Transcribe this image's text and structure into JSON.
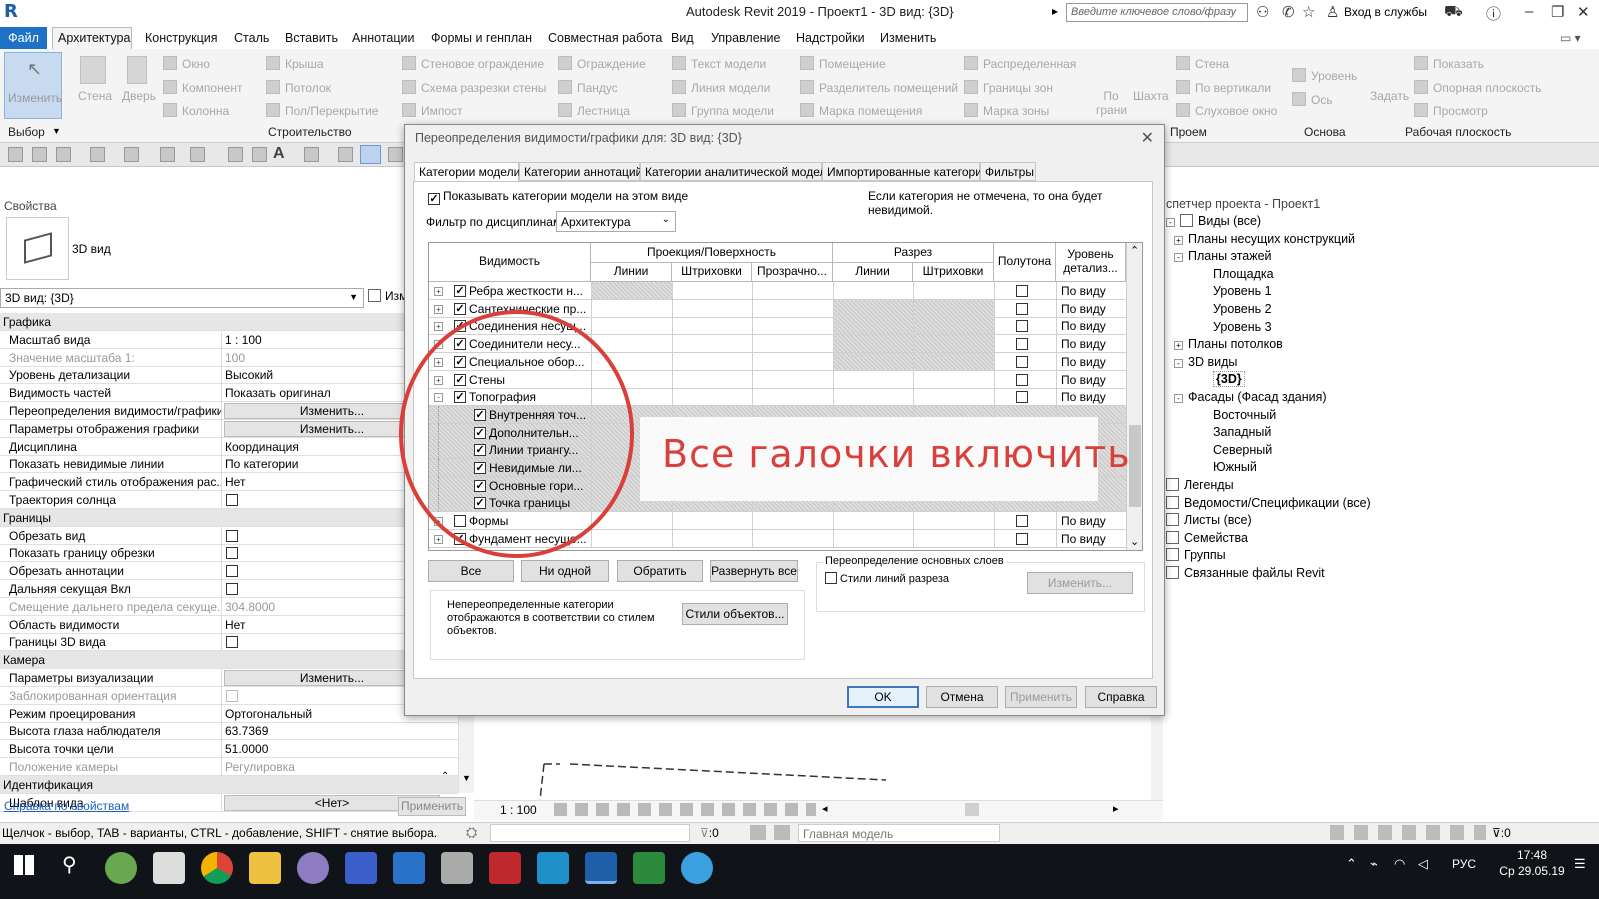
{
  "app": {
    "title": "Autodesk Revit 2019 - Проект1 - 3D вид: {3D}",
    "logo": "R",
    "search_placeholder": "Введите ключевое слово/фразу",
    "signin": "Вход в службы"
  },
  "menu": {
    "file": "Файл",
    "tabs": [
      "Архитектура",
      "Конструкция",
      "Сталь",
      "Вставить",
      "Аннотации",
      "Формы и генплан",
      "Совместная работа",
      "Вид",
      "Управление",
      "Надстройки",
      "Изменить"
    ]
  },
  "ribbon": {
    "select_label": "Изменить",
    "select_group": "Выбор",
    "wall": "Стена",
    "door": "Дверь",
    "window": "Окно",
    "component": "Компонент",
    "column": "Колонна",
    "roof": "Крыша",
    "ceiling": "Потолок",
    "floor": "Пол/Перекрытие",
    "curtain": "Стеновое ограждение",
    "curtain_grid": "Схема разрезки стены",
    "mullion": "Импост",
    "railing": "Ограждение",
    "ramp": "Пандус",
    "stair": "Лестница",
    "build_group": "Строительство",
    "model_text": "Текст модели",
    "model_line": "Линия модели",
    "model_group": "Группа модели",
    "room": "Помещение",
    "room_sep": "Разделитель помещений",
    "room_tag": "Марка помещения",
    "area": "Распределенная",
    "area_bound": "Границы зон",
    "area_tag": "Марка зоны",
    "by_face": "По грани",
    "shaft": "Шахта",
    "wall_open": "Стена",
    "vertical": "По вертикали",
    "dormer": "Слуховое окно",
    "opening_group": "Проем",
    "level": "Уровень",
    "grid": "Ось",
    "datum_group": "Основа",
    "set": "Задать",
    "show": "Показать",
    "ref_plane": "Опорная плоскость",
    "viewer": "Просмотр",
    "workplane_group": "Рабочая плоскость"
  },
  "properties": {
    "header": "Свойства",
    "type_name": "3D вид",
    "selector": "3D вид: {3D}",
    "edit_type": "Изм",
    "rows": [
      {
        "k": "Графика",
        "cat": true
      },
      {
        "k": "Масштаб вида",
        "v": "1 : 100"
      },
      {
        "k": "Значение масштаба    1:",
        "v": "100",
        "gray": true
      },
      {
        "k": "Уровень детализации",
        "v": "Высокий"
      },
      {
        "k": "Видимость частей",
        "v": "Показать оригинал"
      },
      {
        "k": "Переопределения видимости/графики",
        "btn": "Изменить..."
      },
      {
        "k": "Параметры отображения графики",
        "btn": "Изменить..."
      },
      {
        "k": "Дисциплина",
        "v": "Координация"
      },
      {
        "k": "Показать невидимые линии",
        "v": "По категории"
      },
      {
        "k": "Графический стиль отображения рас...",
        "v": "Нет"
      },
      {
        "k": "Траектория солнца",
        "chk": true
      },
      {
        "k": "Границы",
        "cat": true
      },
      {
        "k": "Обрезать вид",
        "chk": true
      },
      {
        "k": "Показать границу обрезки",
        "chk": true
      },
      {
        "k": "Обрезать аннотации",
        "chk": true
      },
      {
        "k": "Дальняя секущая Вкл",
        "chk": true
      },
      {
        "k": "Смещение дальнего предела секуще...",
        "v": "304.8000",
        "gray": true
      },
      {
        "k": "Область видимости",
        "v": "Нет"
      },
      {
        "k": "Границы 3D вида",
        "chk": true
      },
      {
        "k": "Камера",
        "cat": true
      },
      {
        "k": "Параметры визуализации",
        "btn": "Изменить..."
      },
      {
        "k": "Заблокированная ориентация",
        "chk": true,
        "gray": true
      },
      {
        "k": "Режим проецирования",
        "v": "Ортогональный"
      },
      {
        "k": "Высота глаза наблюдателя",
        "v": "63.7369"
      },
      {
        "k": "Высота точки цели",
        "v": "51.0000"
      },
      {
        "k": "Положение камеры",
        "v": "Регулировка",
        "gray": true
      },
      {
        "k": "Идентификация",
        "cat": true
      },
      {
        "k": "Шаблон вида",
        "btn": "<Нет>"
      }
    ],
    "help_link": "Справка по свойствам",
    "apply": "Применить"
  },
  "browser": {
    "header": "спетчер проекта - Проект1",
    "items": [
      {
        "t": "Виды (все)",
        "lvl": 0,
        "ico": true,
        "pm": "-"
      },
      {
        "t": "Планы несущих конструкций",
        "lvl": 1,
        "pm": "+"
      },
      {
        "t": "Планы этажей",
        "lvl": 1,
        "pm": "-"
      },
      {
        "t": "Площадка",
        "lvl": 2
      },
      {
        "t": "Уровень 1",
        "lvl": 2
      },
      {
        "t": "Уровень 2",
        "lvl": 2
      },
      {
        "t": "Уровень 3",
        "lvl": 2
      },
      {
        "t": "Планы потолков",
        "lvl": 1,
        "pm": "+"
      },
      {
        "t": "3D виды",
        "lvl": 1,
        "pm": "-"
      },
      {
        "t": "{3D}",
        "lvl": 2,
        "bold": true
      },
      {
        "t": "Фасады (Фасад здания)",
        "lvl": 1,
        "pm": "-"
      },
      {
        "t": "Восточный",
        "lvl": 2
      },
      {
        "t": "Западный",
        "lvl": 2
      },
      {
        "t": "Северный",
        "lvl": 2
      },
      {
        "t": "Южный",
        "lvl": 2
      },
      {
        "t": "Легенды",
        "lvl": 0,
        "ico": true
      },
      {
        "t": "Ведомости/Спецификации (все)",
        "lvl": 0,
        "ico": true
      },
      {
        "t": "Листы (все)",
        "lvl": 0,
        "ico": true
      },
      {
        "t": "Семейства",
        "lvl": 0,
        "ico": true
      },
      {
        "t": "Группы",
        "lvl": 0,
        "ico": true
      },
      {
        "t": "Связанные файлы Revit",
        "lvl": 0,
        "ico": true
      }
    ]
  },
  "dialog": {
    "title": "Переопределения видимости/графики для: 3D вид: {3D}",
    "tabs": [
      "Категории модели",
      "Категории аннотаций",
      "Категории аналитической модели",
      "Импортированные категории",
      "Фильтры"
    ],
    "show_categories": "Показывать категории модели на этом виде",
    "hint": "Если категория не отмечена, то она будет невидимой.",
    "filter_label": "Фильтр по дисциплинам:",
    "filter_value": "Архитектура",
    "headers": {
      "visibility": "Видимость",
      "projection": "Проекция/Поверхность",
      "cut": "Разрез",
      "lines": "Линии",
      "patterns": "Штриховки",
      "transparency": "Прозрачно...",
      "halftone": "Полутона",
      "detail": "Уровень детализ..."
    },
    "rows": [
      {
        "name": "Ребра жесткости н...",
        "exp": "+",
        "on": true,
        "half": true,
        "lv": "По виду",
        "h": [
          2
        ]
      },
      {
        "name": "Сантехнические пр...",
        "exp": "+",
        "on": true,
        "half": true,
        "lv": "По виду",
        "h": [
          5,
          6
        ]
      },
      {
        "name": "Соединения несущ...",
        "exp": "+",
        "on": true,
        "half": true,
        "lv": "По виду",
        "h": [
          5,
          6
        ]
      },
      {
        "name": "Соединители несу...",
        "exp": "+",
        "on": true,
        "half": true,
        "lv": "По виду",
        "h": [
          5,
          6
        ]
      },
      {
        "name": "Специальное обор...",
        "exp": "+",
        "on": true,
        "half": true,
        "lv": "По виду",
        "h": [
          5,
          6
        ]
      },
      {
        "name": "Стены",
        "exp": "+",
        "on": true,
        "half": true,
        "lv": "По виду",
        "h": []
      },
      {
        "name": "Топография",
        "exp": "-",
        "on": true,
        "half": true,
        "lv": "По виду",
        "h": []
      },
      {
        "name": "Внутренняя точ...",
        "child": true,
        "on": true,
        "h": [
          1,
          2,
          3,
          4,
          5,
          6,
          7,
          8
        ]
      },
      {
        "name": "Дополнительн...",
        "child": true,
        "on": true,
        "h": [
          1,
          2,
          3,
          4,
          5,
          6,
          7,
          8
        ]
      },
      {
        "name": "Линии триангу...",
        "child": true,
        "on": true,
        "h": [
          1,
          2,
          3,
          4,
          5,
          6,
          7,
          8
        ]
      },
      {
        "name": "Невидимые ли...",
        "child": true,
        "on": true,
        "h": [
          1,
          2,
          3,
          4,
          5,
          6,
          7,
          8
        ]
      },
      {
        "name": "Основные гори...",
        "child": true,
        "on": true,
        "h": [
          1,
          2,
          3,
          4,
          5,
          6,
          7,
          8
        ]
      },
      {
        "name": "Точка границы",
        "child": true,
        "on": true,
        "h": [
          1,
          2,
          3,
          4,
          5,
          6,
          7,
          8
        ]
      },
      {
        "name": "Формы",
        "exp": "+",
        "on": false,
        "half": true,
        "lv": "По виду",
        "h": []
      },
      {
        "name": "Фундамент несуще...",
        "exp": "+",
        "on": true,
        "half": true,
        "lv": "По виду",
        "h": []
      }
    ],
    "btn_all": "Все",
    "btn_none": "Ни одной",
    "btn_invert": "Обратить",
    "btn_expand": "Развернуть все",
    "note": "Непереопределенные категории отображаются в соответствии со стилем объектов.",
    "btn_styles": "Стили объектов...",
    "override_group": "Переопределение основных слоев",
    "cut_styles": "Стили линий разреза",
    "btn_edit": "Изменить...",
    "ok": "OK",
    "cancel": "Отмена",
    "apply": "Применить",
    "help": "Справка"
  },
  "annotation": {
    "text": "Все галочки включить",
    "color": "#d9403b"
  },
  "canvas": {
    "scale": "1 : 100"
  },
  "status": {
    "hint": "Щелчок - выбор, TAB - варианты, CTRL - добавление, SHIFT - снятие выбора.",
    "count": ":0",
    "model": "Главная модель",
    "right_count": ":0"
  },
  "taskbar": {
    "lang": "РУС",
    "time": "17:48",
    "date": "Ср 29.05.19"
  }
}
